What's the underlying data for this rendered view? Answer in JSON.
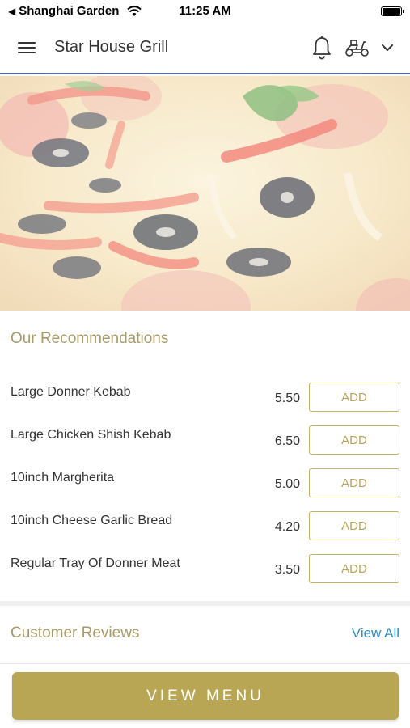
{
  "status_bar": {
    "carrier": "Shanghai Garden",
    "time": "11:25 AM"
  },
  "app_bar": {
    "title": "Star House Grill"
  },
  "recommendations": {
    "title": "Our Recommendations",
    "items": [
      {
        "name": "Large Donner Kebab",
        "price": "5.50",
        "button": "ADD"
      },
      {
        "name": "Large Chicken Shish Kebab",
        "price": "6.50",
        "button": "ADD"
      },
      {
        "name": "10inch Margherita",
        "price": "5.00",
        "button": "ADD"
      },
      {
        "name": "10inch Cheese Garlic Bread",
        "price": "4.20",
        "button": "ADD"
      },
      {
        "name": "Regular Tray Of Donner Meat",
        "price": "3.50",
        "button": "ADD"
      }
    ]
  },
  "reviews": {
    "title": "Customer Reviews",
    "view_all": "View All"
  },
  "footer": {
    "view_menu": "VIEW MENU"
  },
  "colors": {
    "accent_gold": "#b8a655",
    "link_blue": "#2f8fc8",
    "header_border": "#5a6b9c"
  },
  "icons": [
    "back-arrow-icon",
    "wifi-icon",
    "battery-icon",
    "menu-icon",
    "bell-icon",
    "delivery-scooter-icon",
    "chevron-down-icon"
  ]
}
